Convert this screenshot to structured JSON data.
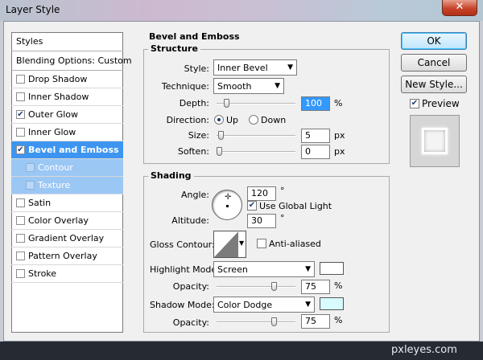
{
  "window": {
    "title": "Layer Style",
    "close_label": "✕"
  },
  "watermark": "pxleyes.com",
  "styles_panel": {
    "header": "Styles",
    "blending_options": "Blending Options: Custom",
    "items": [
      {
        "label": "Drop Shadow",
        "checked": false
      },
      {
        "label": "Inner Shadow",
        "checked": false
      },
      {
        "label": "Outer Glow",
        "checked": true
      },
      {
        "label": "Inner Glow",
        "checked": false
      },
      {
        "label": "Bevel and Emboss",
        "checked": true,
        "selected": true
      },
      {
        "label": "Contour",
        "checked": false,
        "sub": true
      },
      {
        "label": "Texture",
        "checked": false,
        "sub": true
      },
      {
        "label": "Satin",
        "checked": false
      },
      {
        "label": "Color Overlay",
        "checked": false
      },
      {
        "label": "Gradient Overlay",
        "checked": false
      },
      {
        "label": "Pattern Overlay",
        "checked": false
      },
      {
        "label": "Stroke",
        "checked": false
      }
    ]
  },
  "bevel": {
    "section_title": "Bevel and Emboss",
    "structure": {
      "title": "Structure",
      "style_label": "Style:",
      "style_value": "Inner Bevel",
      "technique_label": "Technique:",
      "technique_value": "Smooth",
      "depth_label": "Depth:",
      "depth_value": "100",
      "depth_unit": "%",
      "depth_slider": 0.1,
      "direction_label": "Direction:",
      "dir_up": "Up",
      "dir_down": "Down",
      "direction_selected": "Up",
      "size_label": "Size:",
      "size_value": "5",
      "size_unit": "px",
      "size_slider": 0.02,
      "soften_label": "Soften:",
      "soften_value": "0",
      "soften_unit": "px",
      "soften_slider": 0.0
    },
    "shading": {
      "title": "Shading",
      "angle_label": "Angle:",
      "angle_value": "120",
      "angle_unit": "°",
      "global_light_label": "Use Global Light",
      "global_light": true,
      "altitude_label": "Altitude:",
      "altitude_value": "30",
      "altitude_unit": "°",
      "gloss_label": "Gloss Contour:",
      "antialiased_label": "Anti-aliased",
      "antialiased": false,
      "highlight_label": "Highlight Mode:",
      "highlight_value": "Screen",
      "highlight_color": "#ffffff",
      "h_opacity_label": "Opacity:",
      "h_opacity_value": "75",
      "h_opacity_unit": "%",
      "h_opacity_slider": 0.75,
      "shadow_label": "Shadow Mode:",
      "shadow_value": "Color Dodge",
      "shadow_color": "#d8fbff",
      "s_opacity_label": "Opacity:",
      "s_opacity_value": "75",
      "s_opacity_unit": "%",
      "s_opacity_slider": 0.75
    }
  },
  "buttons": {
    "ok": "OK",
    "cancel": "Cancel",
    "new_style": "New Style...",
    "preview": "Preview",
    "preview_checked": true
  }
}
